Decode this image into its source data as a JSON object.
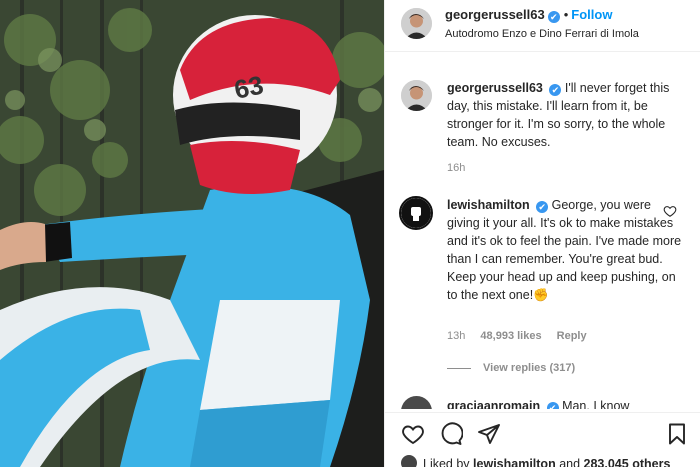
{
  "post_header": {
    "username": "georgerussell63",
    "verified_mark": "✔",
    "separator": "•",
    "follow_label": "Follow",
    "location": "Autodromo Enzo e Dino Ferrari di Imola"
  },
  "caption": {
    "username": "georgerussell63",
    "text": "I'll never forget this day, this mistake. I'll learn from it, be stronger for it. I'm so sorry, to the whole team. No excuses.",
    "time": "16h"
  },
  "comment": {
    "username": "lewishamilton",
    "text": "George, you were giving it your all. It's ok to make mistakes and it's ok to feel the pain. I've made more than I can remember. You're great bud. Keep your head up and keep pushing, on to the next one!",
    "emoji": "✊",
    "time": "13h",
    "likes": "48,993 likes",
    "reply_label": "Reply",
    "view_replies": "View replies (317)"
  },
  "next_comment": {
    "username": "graciaanromain",
    "text": "Man, I know"
  },
  "actions": {
    "icons": [
      "heart-icon",
      "comment-icon",
      "share-icon",
      "bookmark-icon"
    ],
    "liked_prefix": "Liked by",
    "liked_user": "lewishamilton",
    "liked_and": "and",
    "liked_count": "283,045 others"
  },
  "colors": {
    "link_blue": "#0095f6",
    "verified_blue": "#3897f0",
    "secondary_text": "#8e8e8e",
    "suit_blue": "#3ab2e6"
  }
}
